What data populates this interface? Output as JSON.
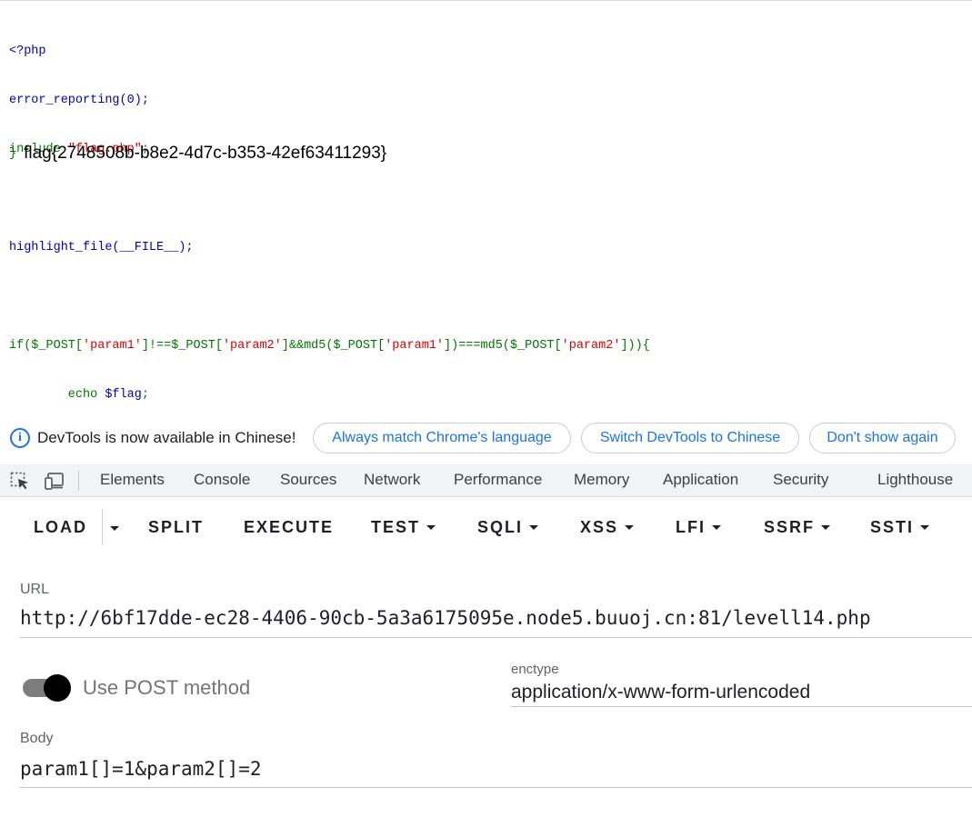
{
  "source_code": {
    "line1": "<?php",
    "line2": "error_reporting(0);",
    "line3_keyword": "include ",
    "line3_string": "\"flag.php\"",
    "line3_end": ";",
    "line5": "highlight_file(__FILE__);",
    "line7_a": "if($_POST[",
    "line7_b": "'param1'",
    "line7_c": "]!==$_POST[",
    "line7_d": "'param2'",
    "line7_e": "]&&md5($_POST[",
    "line7_f": "'param1'",
    "line7_g": "])===md5($_POST[",
    "line7_h": "'param2'",
    "line7_i": "])){",
    "line8_keyword": "        echo ",
    "line8_var": "$flag",
    "line8_end": ";",
    "closing_brace": "}",
    "flag_output": "flag{2748508b-b8e2-4d7c-b353-42ef63411293}"
  },
  "devtools": {
    "infobar": {
      "message": "DevTools is now available in Chinese!",
      "btn_match": "Always match Chrome's language",
      "btn_switch": "Switch DevTools to Chinese",
      "btn_dismiss": "Don't show again"
    },
    "tabs": {
      "elements": "Elements",
      "console": "Console",
      "sources": "Sources",
      "network": "Network",
      "performance": "Performance",
      "memory": "Memory",
      "application": "Application",
      "security": "Security",
      "lighthouse": "Lighthouse"
    }
  },
  "hackbar": {
    "toolbar": {
      "load": "LOAD",
      "split": "SPLIT",
      "execute": "EXECUTE",
      "test": "TEST",
      "sqli": "SQLI",
      "xss": "XSS",
      "lfi": "LFI",
      "ssrf": "SSRF",
      "ssti": "SSTI"
    },
    "url_label": "URL",
    "url_value": "http://6bf17dde-ec28-4406-90cb-5a3a6175095e.node5.buuoj.cn:81/levell14.php",
    "post_toggle_label": "Use POST method",
    "post_enabled": true,
    "enctype_label": "enctype",
    "enctype_value": "application/x-www-form-urlencoded",
    "body_label": "Body",
    "body_value": "param1[]=1&param2[]=2"
  },
  "colors": {
    "accent": "#1a73e8",
    "php_default": "#0000bb",
    "php_keyword": "#007700",
    "php_string": "#dd0000"
  }
}
